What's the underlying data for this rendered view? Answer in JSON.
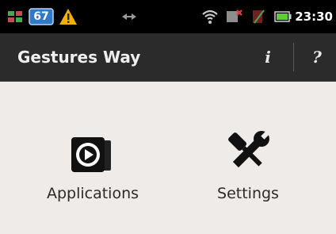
{
  "status_bar": {
    "time": "23:30",
    "notification_badge": "67",
    "icons": [
      "usb-debug-icon",
      "badge-icon",
      "warning-icon",
      "sync-arrows-icon",
      "wifi-icon",
      "signal-icon",
      "missing-sim-icon",
      "battery-icon"
    ]
  },
  "action_bar": {
    "title": "Gestures Way",
    "info_label": "i",
    "help_label": "?"
  },
  "main": {
    "tiles": [
      {
        "label": "Applications",
        "icon": "applications-icon"
      },
      {
        "label": "Settings",
        "icon": "settings-icon"
      }
    ]
  },
  "colors": {
    "status_bar_bg": "#000000",
    "action_bar_bg": "#2b2b2b",
    "content_bg": "#efebe9",
    "warning": "#f2b000",
    "badge_blue": "#2f79c8",
    "battery_green": "#5ecb3a"
  }
}
